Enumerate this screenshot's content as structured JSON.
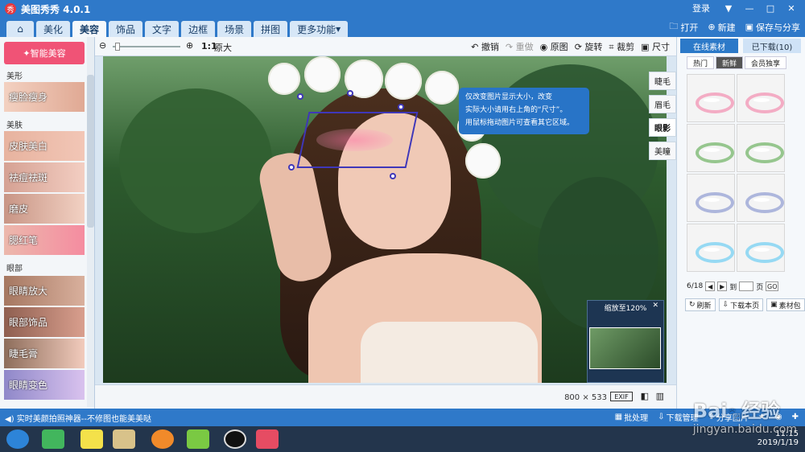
{
  "window": {
    "title": "美图秀秀 4.0.1",
    "login": "登录"
  },
  "nav": {
    "tabs": [
      "美化",
      "美容",
      "饰品",
      "文字",
      "边框",
      "场景",
      "拼图",
      "更多功能"
    ],
    "active_index": 1,
    "right": {
      "open": "打开",
      "new": "新建",
      "save_share": "保存与分享"
    }
  },
  "left_panel": {
    "beauty_button": "智能美容",
    "sections": [
      {
        "label": "美形",
        "items": [
          "瘦脸瘦身"
        ]
      },
      {
        "label": "美肤",
        "items": [
          "皮肤美白",
          "祛痘祛斑",
          "磨皮",
          "腮红笔"
        ]
      },
      {
        "label": "眼部",
        "items": [
          "眼睛放大",
          "眼部饰品",
          "睫毛膏",
          "眼睛变色"
        ]
      }
    ]
  },
  "toolbar": {
    "zoom_label": "1:1",
    "original_size": "原大",
    "actions": [
      "撤销",
      "重做",
      "原图",
      "旋转",
      "裁剪",
      "尺寸"
    ]
  },
  "tooltip": {
    "lines": [
      "仅改变图片显示大小，改变",
      "实际大小请用右上角的“尺寸”。",
      "用鼠标拖动图片可查看其它区域。"
    ]
  },
  "side_tabs": [
    "睫毛",
    "眉毛",
    "眼影",
    "美瞳"
  ],
  "preview": {
    "zoom_text": "缩放至120%"
  },
  "image_meta": {
    "width": 800,
    "height": 533,
    "exif": "EXIF"
  },
  "right_panel": {
    "tab_online": "在线素材",
    "tab_downloaded": "已下载(10)",
    "subtabs": [
      "热门",
      "新鲜",
      "会员独享"
    ],
    "page_info": "6/18",
    "to_label": "到",
    "page_label": "页",
    "go": "GO",
    "buttons": [
      "刷新",
      "下载本页",
      "素材包"
    ]
  },
  "statusbar": {
    "message": "实时美颜拍照神器--不修图也能美美哒",
    "actions": [
      "批处理",
      "下载管理",
      "分享图片"
    ]
  },
  "taskbar": {
    "time": "11:15",
    "date": "2019/1/19"
  },
  "watermark": {
    "brand": "Bai",
    "text": "经验",
    "url": "jingyan.baidu.com"
  },
  "colors": {
    "titlebar": "#2f79c9",
    "accent": "#f05376",
    "selection": "#3f37b9"
  },
  "asset_colors": [
    "#f27ca4",
    "#f27ca4",
    "#57a64a",
    "#57a64a",
    "#7d8ccc",
    "#7d8ccc",
    "#56c7f2",
    "#56c7f2"
  ]
}
